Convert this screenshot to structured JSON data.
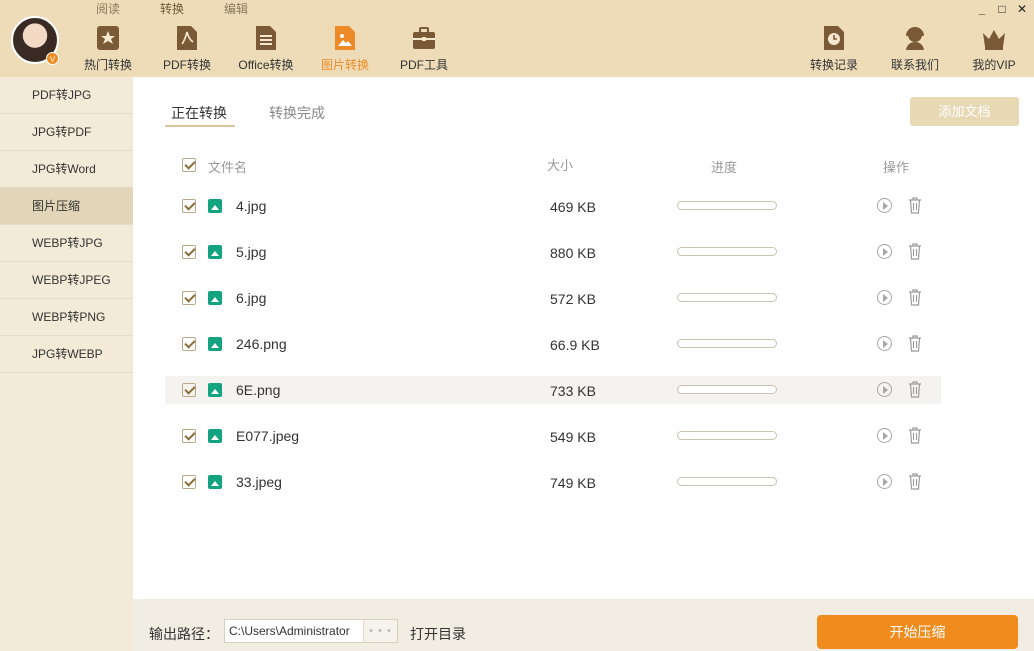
{
  "mode_tabs": [
    "阅读",
    "转换",
    "编辑"
  ],
  "window_controls": {
    "minimize": "_",
    "maximize": "□",
    "close": "✕"
  },
  "avatar_badge": "V",
  "nav": {
    "hot": "热门转换",
    "pdf": "PDF转换",
    "office": "Office转换",
    "image": "图片转换",
    "pdftools": "PDF工具",
    "history": "转换记录",
    "contact": "联系我们",
    "vip": "我的VIP"
  },
  "sidebar": [
    "PDF转JPG",
    "JPG转PDF",
    "JPG转Word",
    "图片压缩",
    "WEBP转JPG",
    "WEBP转JPEG",
    "WEBP转PNG",
    "JPG转WEBP"
  ],
  "tabs": {
    "converting": "正在转换",
    "done": "转换完成"
  },
  "add_button": "添加文档",
  "columns": {
    "name": "文件名",
    "size": "大小",
    "progress": "进度",
    "action": "操作"
  },
  "files": [
    {
      "name": "4.jpg",
      "size": "469 KB",
      "progress": 0
    },
    {
      "name": "5.jpg",
      "size": "880 KB",
      "progress": 0
    },
    {
      "name": "6.jpg",
      "size": "572 KB",
      "progress": 0
    },
    {
      "name": "246.png",
      "size": "66.9 KB",
      "progress": 0
    },
    {
      "name": "6E.png",
      "size": "733 KB",
      "progress": 0
    },
    {
      "name": "E077.jpeg",
      "size": "549 KB",
      "progress": 0
    },
    {
      "name": "33.jpeg",
      "size": "749 KB",
      "progress": 0
    }
  ],
  "output": {
    "label": "输出路径：",
    "path": "C:\\Users\\Administrator",
    "browse": "• • •",
    "open_dir": "打开目录"
  },
  "start_button": "开始压缩",
  "colors": {
    "header": "#eedcb8",
    "accent": "#f08b1e",
    "sidebar": "#f3ead7",
    "file_icon": "#13a380"
  }
}
